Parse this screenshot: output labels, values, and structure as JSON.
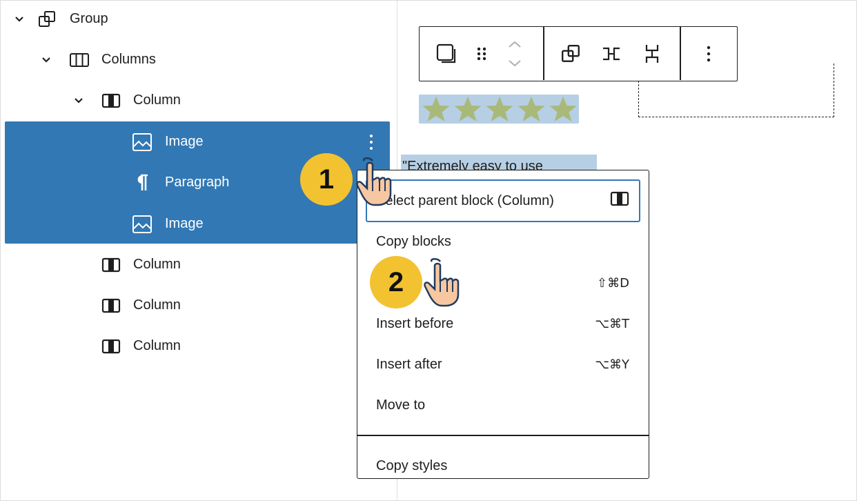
{
  "list_view": {
    "rows": [
      {
        "label": "Group",
        "icon": "group-icon",
        "expanded": true
      },
      {
        "label": "Columns",
        "icon": "columns-icon",
        "expanded": true
      },
      {
        "label": "Column",
        "icon": "column-icon",
        "expanded": true
      },
      {
        "label": "Image",
        "icon": "image-icon",
        "selected": true
      },
      {
        "label": "Paragraph",
        "icon": "paragraph-icon",
        "selected": true
      },
      {
        "label": "Image",
        "icon": "image-icon",
        "selected": true
      },
      {
        "label": "Column",
        "icon": "column-icon"
      },
      {
        "label": "Column",
        "icon": "column-icon"
      },
      {
        "label": "Column",
        "icon": "column-icon"
      }
    ]
  },
  "toolbar": {
    "buttons": [
      "parent-select-icon",
      "drag-handle-icon",
      "move-up-down-icon",
      "group-icon",
      "row-icon",
      "stack-icon",
      "more-options-icon"
    ]
  },
  "editor": {
    "rating_stars": 5,
    "paragraph_text": "\"Extremely easy to use"
  },
  "menu": {
    "items": [
      {
        "label": "Select parent block (Column)",
        "shortcut": "",
        "focused": true
      },
      {
        "label": "Copy blocks",
        "shortcut": ""
      },
      {
        "label": "",
        "shortcut": "⇧⌘D"
      },
      {
        "label": "Insert before",
        "shortcut": "⌥⌘T"
      },
      {
        "label": "Insert after",
        "shortcut": "⌥⌘Y"
      },
      {
        "label": "Move to",
        "shortcut": ""
      },
      {
        "label": "Copy styles",
        "shortcut": ""
      }
    ]
  },
  "callouts": {
    "step1": "1",
    "step2": "2"
  },
  "colors": {
    "selection": "#3278b4",
    "highlight": "#b6cfe4",
    "badge": "#f2c230",
    "star": "#a9b97a"
  }
}
